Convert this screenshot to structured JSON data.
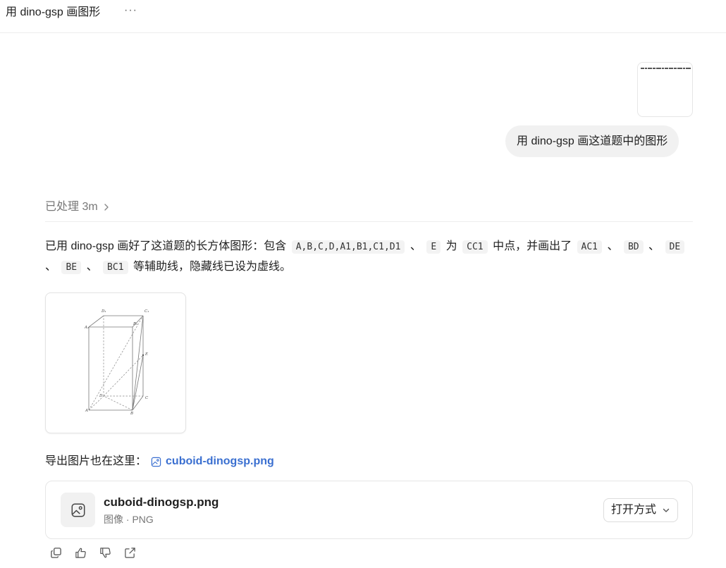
{
  "header": {
    "title": "用 dino-gsp 画图形",
    "more_label": "···"
  },
  "user_message": {
    "attachment_preview_text": "",
    "text": "用 dino-gsp 画这道题中的图形"
  },
  "assistant": {
    "processed_label": "已处理 3m",
    "answer": {
      "t1": "已用 dino-gsp 画好了这道题的长方体图形：包含",
      "c1": "A,B,C,D,A1,B1,C1,D1",
      "t2": "、",
      "c2": "E",
      "t3": "为",
      "c3": "CC1",
      "t4": "中点，并画出了",
      "c4": "AC1",
      "t5": "、",
      "c5": "BD",
      "t6": "、",
      "c6": "DE",
      "t7": "、",
      "c7": "BE",
      "t8": "、",
      "c8": "BC1",
      "t9": "等辅助线，隐藏线已设为虚线。"
    },
    "figure_labels": {
      "D1": "D₁",
      "C1": "C₁",
      "A1": "A₁",
      "B1": "B₁",
      "E": "E",
      "C": "C",
      "D": "D",
      "A": "A",
      "B": "B"
    },
    "export_text": "导出图片也在这里：",
    "export_link": "cuboid-dinogsp.png",
    "file": {
      "name": "cuboid-dinogsp.png",
      "meta": "图像 · PNG",
      "open_label": "打开方式"
    }
  },
  "icons": {
    "more": "more-icon",
    "chevron": "chevron-right-icon",
    "image": "image-icon",
    "copy": "copy-icon",
    "like": "thumbs-up-icon",
    "dislike": "thumbs-down-icon",
    "share": "share-icon"
  },
  "colors": {
    "link": "#3a6fd0",
    "bubble": "#f1f1f1",
    "muted": "#777777"
  }
}
